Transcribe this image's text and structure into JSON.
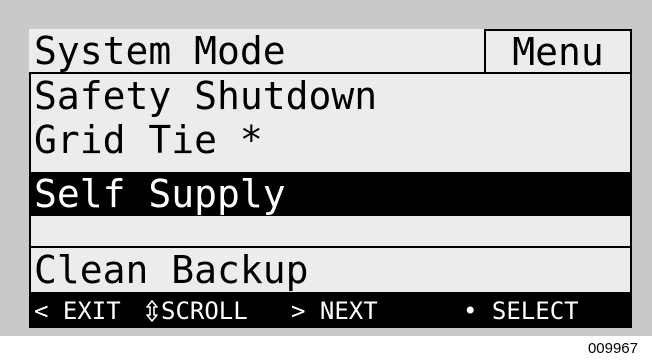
{
  "screen": {
    "title": "System Mode",
    "menu_tab": "Menu",
    "items": [
      {
        "label": "Safety Shutdown"
      },
      {
        "label": "Grid Tie *"
      },
      {
        "label": "Self Supply"
      },
      {
        "label": "Clean Backup"
      }
    ],
    "selected_item": "Self Supply",
    "footer": {
      "exit": "< EXIT",
      "scroll_icon": "up-down-arrow-icon",
      "scroll": "SCROLL",
      "next": "> NEXT",
      "select": "• SELECT"
    }
  },
  "figure_code": "009967",
  "colors": {
    "bezel": "#c9c9c9",
    "screen": "#ececec",
    "ink": "#000000"
  }
}
